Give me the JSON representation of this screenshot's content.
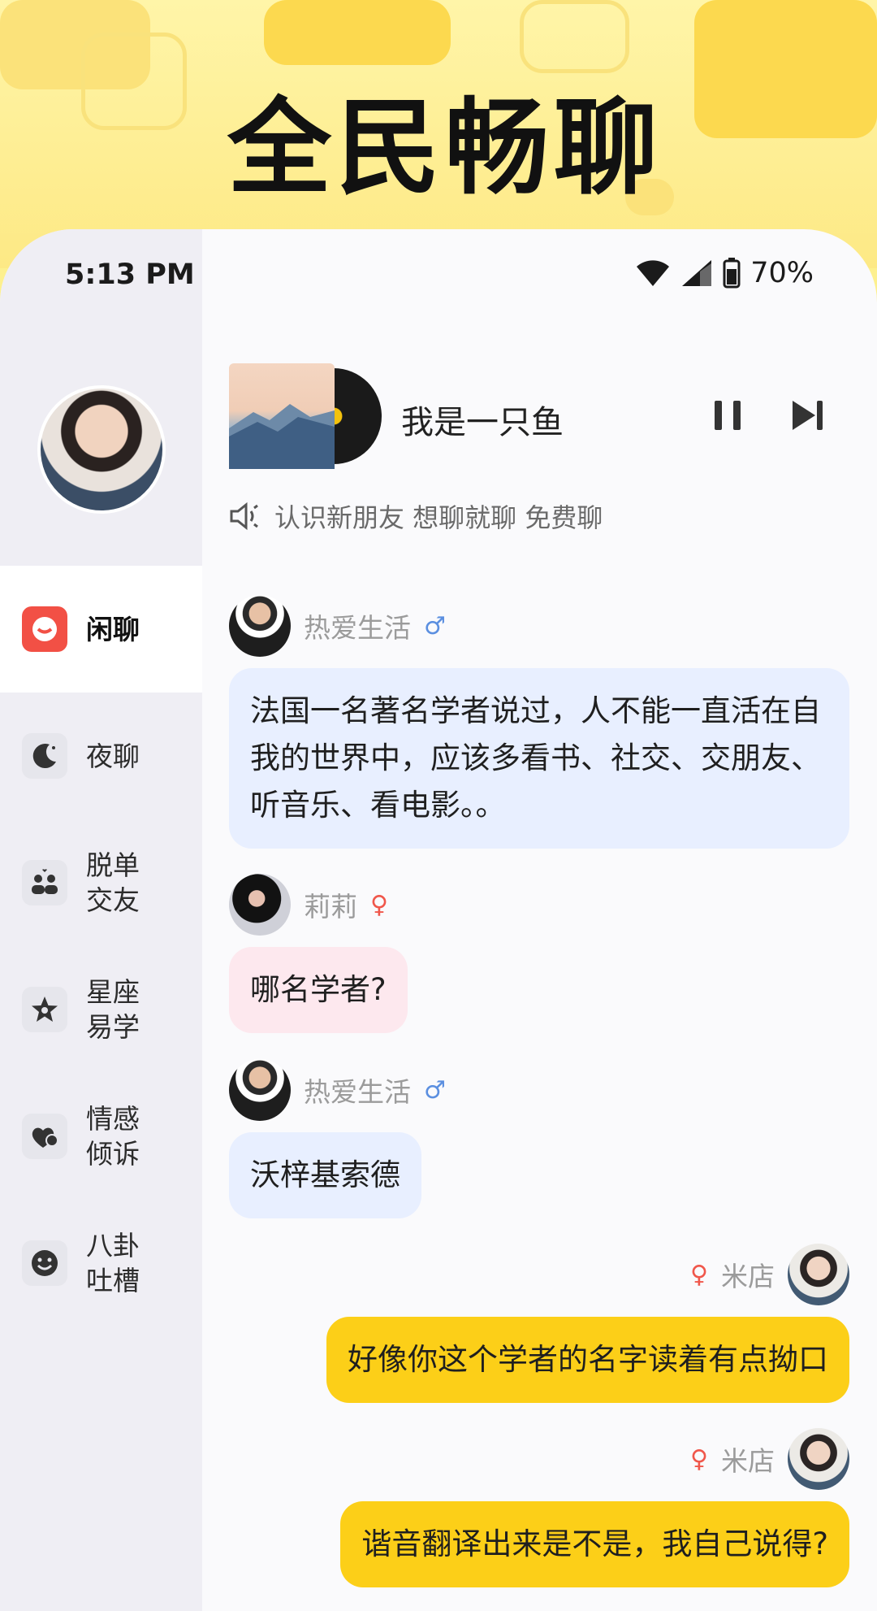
{
  "banner": {
    "title": "全民畅聊"
  },
  "status_bar": {
    "time": "5:13 PM",
    "battery": "70%"
  },
  "sidebar": {
    "items": [
      {
        "label": "闲聊",
        "icon": "chat-bubble-icon",
        "active": true
      },
      {
        "label": "夜聊",
        "icon": "moon-icon",
        "active": false
      },
      {
        "label": "脱单\n交友",
        "icon": "couple-icon",
        "active": false
      },
      {
        "label": "星座\n易学",
        "icon": "star-icon",
        "active": false
      },
      {
        "label": "情感\n倾诉",
        "icon": "heart-icon",
        "active": false
      },
      {
        "label": "八卦\n吐槽",
        "icon": "smile-icon",
        "active": false
      }
    ]
  },
  "player": {
    "song_title": "我是一只鱼"
  },
  "notice": {
    "text": "认识新朋友 想聊就聊 免费聊"
  },
  "messages": [
    {
      "user": "热爱生活",
      "gender": "male",
      "text": "法国一名著名学者说过，人不能一直活在自我的世界中，应该多看书、社交、交朋友、听音乐、看电影。。",
      "side": "left"
    },
    {
      "user": "莉莉",
      "gender": "female",
      "text": "哪名学者?",
      "side": "left"
    },
    {
      "user": "热爱生活",
      "gender": "male",
      "text": "沃梓基索德",
      "side": "left"
    },
    {
      "user": "米店",
      "gender": "female",
      "text": "好像你这个学者的名字读着有点拗口",
      "side": "right"
    },
    {
      "user": "米店",
      "gender": "female",
      "text": "谐音翻译出来是不是，我自己说得?",
      "side": "right"
    }
  ],
  "colors": {
    "banner_bg": "#fde985",
    "accent_yellow": "#fccf18",
    "bubble_blue": "#e8efff",
    "bubble_pink": "#fde8ee",
    "active_red": "#f25045"
  }
}
